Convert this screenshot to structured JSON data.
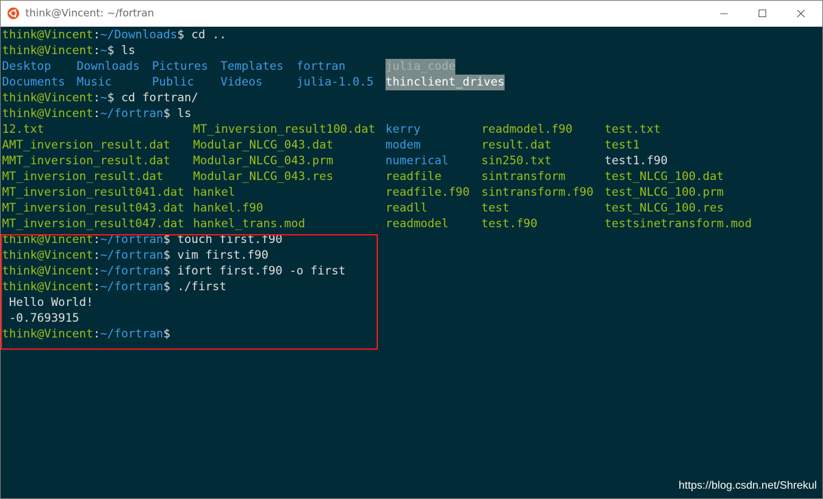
{
  "window": {
    "title": "think@Vincent: ~/fortran",
    "accent_colors": {
      "titlebar": "#ffffff",
      "terminal_bg": "#012b36",
      "prompt": "#9cbf1b",
      "dir": "#3f9be4",
      "highlight_box": "#e81b1b"
    },
    "controls": [
      "minimize-icon",
      "maximize-icon",
      "close-icon"
    ]
  },
  "terminal": {
    "prompt_user": "think@Vincent",
    "lines": [
      {
        "path": "~/Downloads",
        "cmd": " cd .."
      },
      {
        "path": "~",
        "cmd": " ls"
      },
      {
        "path": "~",
        "cmd": " cd fortran/"
      },
      {
        "path": "~/fortran",
        "cmd": " ls"
      },
      {
        "path": "~/fortran",
        "cmd": " touch first.f90"
      },
      {
        "path": "~/fortran",
        "cmd": " vim first.f90"
      },
      {
        "path": "~/fortran",
        "cmd": " ifort first.f90 -o first"
      },
      {
        "path": "~/fortran",
        "cmd": " ./first"
      },
      {
        "path": "~/fortran",
        "cmd": ""
      }
    ],
    "home_listing": {
      "row1": [
        "Desktop",
        "Downloads",
        "Pictures",
        "Templates",
        "fortran",
        "julia_code"
      ],
      "row2": [
        "Documents",
        "Music",
        "Public",
        "Videos",
        "julia-1.0.5",
        "thinclient_drives"
      ]
    },
    "fortran_listing": {
      "col1": [
        "12.txt",
        "AMT_inversion_result.dat",
        "MMT_inversion_result.dat",
        "MT_inversion_result.dat",
        "MT_inversion_result041.dat",
        "MT_inversion_result043.dat",
        "MT_inversion_result047.dat"
      ],
      "col2": [
        "MT_inversion_result100.dat",
        "Modular_NLCG_043.dat",
        "Modular_NLCG_043.prm",
        "Modular_NLCG_043.res",
        "hankel",
        "hankel.f90",
        "hankel_trans.mod"
      ],
      "col3": [
        "kerry",
        "modem",
        "numerical",
        "readfile",
        "readfile.f90",
        "readll",
        "readmodel"
      ],
      "col4": [
        "readmodel.f90",
        "result.dat",
        "sin250.txt",
        "sintransform",
        "sintransform.f90",
        "test",
        "test.f90"
      ],
      "col5": [
        "test.txt",
        "test1",
        "test1.f90",
        "test_NLCG_100.dat",
        "test_NLCG_100.prm",
        "test_NLCG_100.res",
        "testsinetransform.mod"
      ]
    },
    "output": [
      " Hello World!",
      " -0.7693915"
    ]
  },
  "watermark": "https://blog.csdn.net/Shrekul"
}
